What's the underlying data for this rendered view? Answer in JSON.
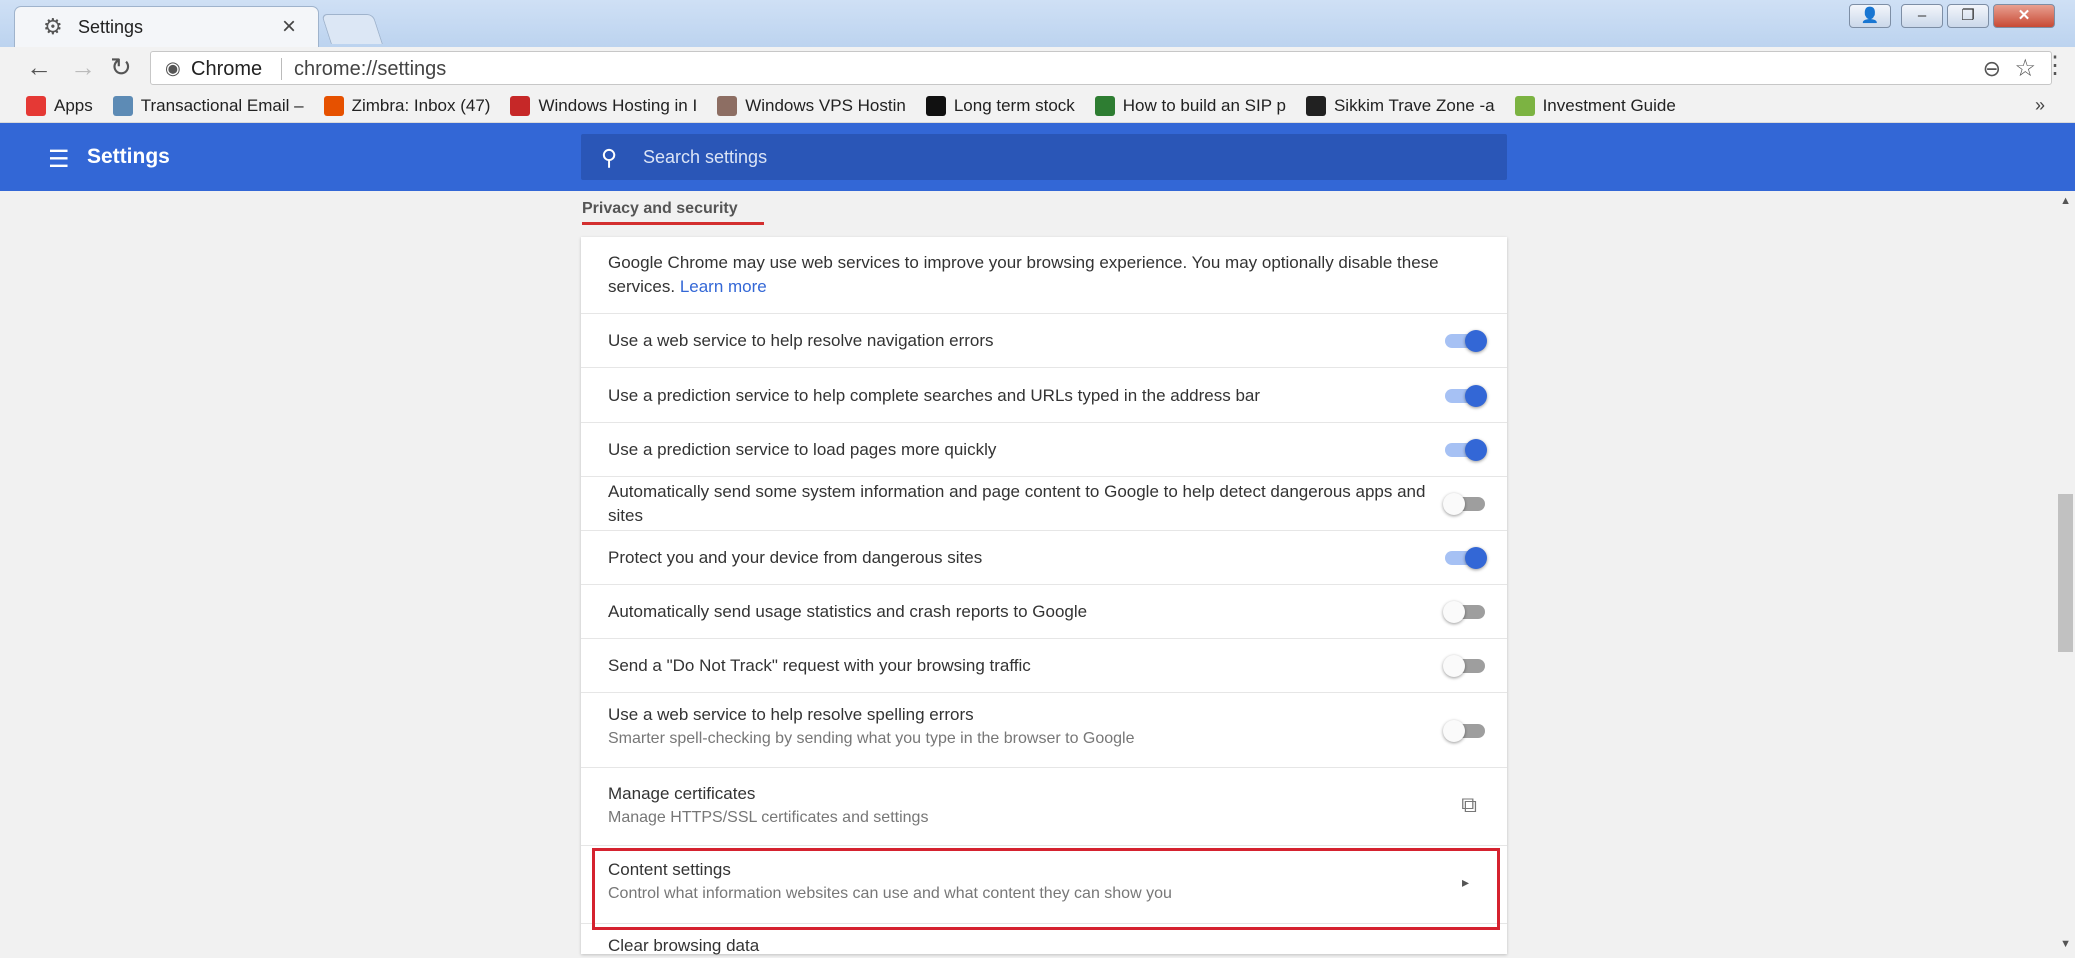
{
  "tab": {
    "title": "Settings"
  },
  "toolbar": {
    "site_label": "Chrome",
    "url": "chrome://settings"
  },
  "bookmarks": [
    {
      "label": "Apps",
      "icon": "apps-grid-icon",
      "color": "#e53935"
    },
    {
      "label": "Transactional Email –",
      "icon": "mail-app-icon",
      "color": "#5d8bb5"
    },
    {
      "label": "Zimbra: Inbox (47)",
      "icon": "zimbra-icon",
      "color": "#e65100"
    },
    {
      "label": "Windows Hosting in I",
      "icon": "e-logo-icon",
      "color": "#c62828"
    },
    {
      "label": "Windows VPS Hostin",
      "icon": "vps-icon",
      "color": "#8d6e63"
    },
    {
      "label": "Long term stock",
      "icon": "stock-icon",
      "color": "#111111"
    },
    {
      "label": "How to build an SIP p",
      "icon": "sip-icon",
      "color": "#2e7d32"
    },
    {
      "label": "Sikkim Trave Zone -a",
      "icon": "tz-icon",
      "color": "#212121"
    },
    {
      "label": "Investment Guide",
      "icon": "clover-icon",
      "color": "#7cb342"
    }
  ],
  "header": {
    "title": "Settings",
    "search_placeholder": "Search settings"
  },
  "section": {
    "title": "Privacy and security"
  },
  "intro": {
    "text": "Google Chrome may use web services to improve your browsing experience. You may optionally disable these services.",
    "link": "Learn more"
  },
  "rows": [
    {
      "label": "Use a web service to help resolve navigation errors",
      "on": true
    },
    {
      "label": "Use a prediction service to help complete searches and URLs typed in the address bar",
      "on": true
    },
    {
      "label": "Use a prediction service to load pages more quickly",
      "on": true
    },
    {
      "label": "Automatically send some system information and page content to Google to help detect dangerous apps and sites",
      "on": false
    },
    {
      "label": "Protect you and your device from dangerous sites",
      "on": true
    },
    {
      "label": "Automatically send usage statistics and crash reports to Google",
      "on": false
    },
    {
      "label": "Send a \"Do Not Track\" request with your browsing traffic",
      "on": false
    },
    {
      "label": "Use a web service to help resolve spelling errors",
      "sub": "Smarter spell-checking by sending what you type in the browser to Google",
      "on": false
    }
  ],
  "certificates": {
    "label": "Manage certificates",
    "sub": "Manage HTTPS/SSL certificates and settings"
  },
  "content_settings": {
    "label": "Content settings",
    "sub": "Control what information websites can use and what content they can show you"
  },
  "clear_browsing": {
    "label": "Clear browsing data"
  },
  "colors": {
    "accent": "#3367d6",
    "highlight": "#d5222f"
  }
}
